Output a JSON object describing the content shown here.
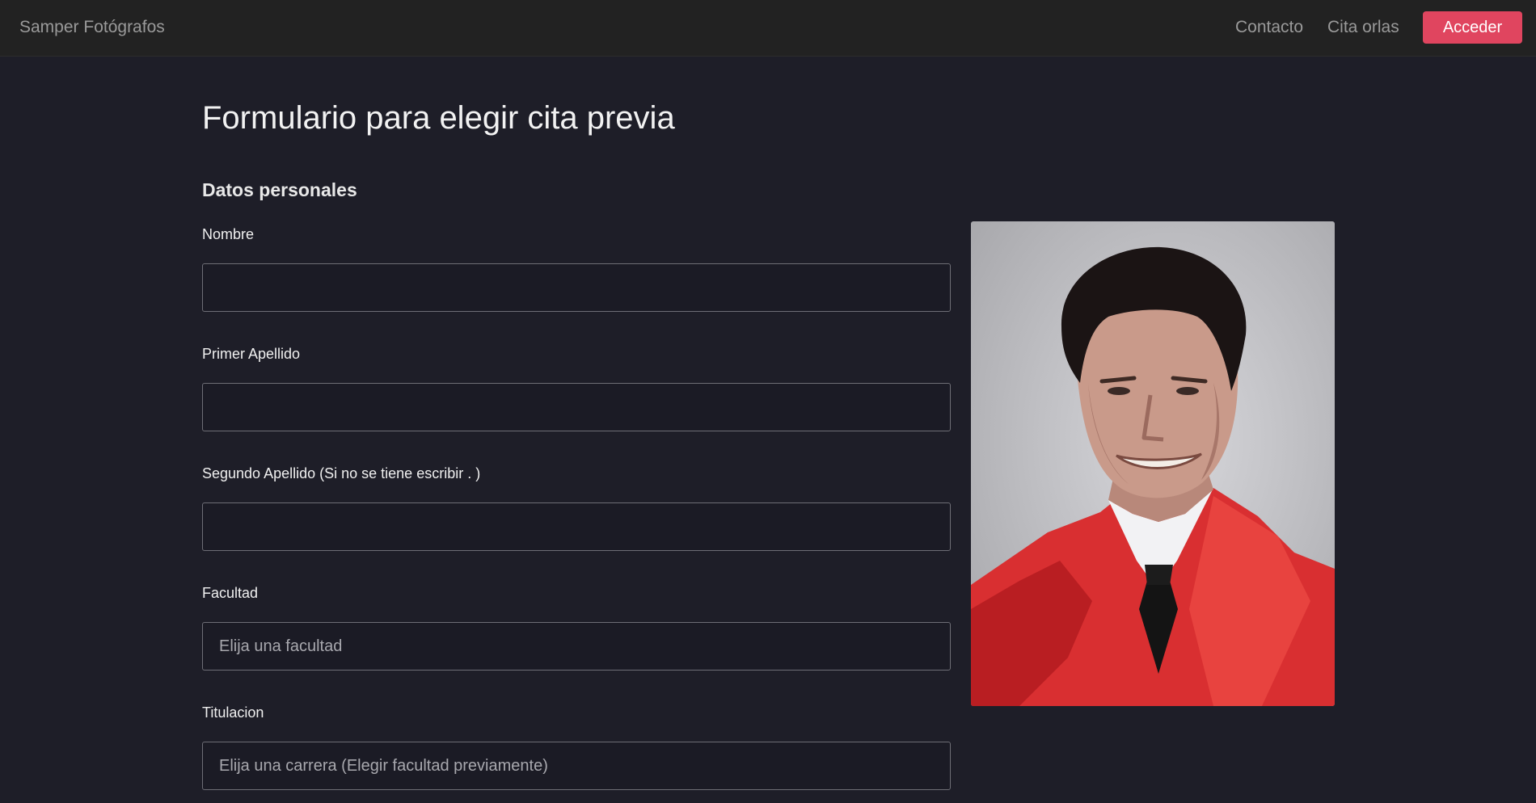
{
  "navbar": {
    "brand": "Samper Fotógrafos",
    "links": [
      "Contacto",
      "Cita orlas"
    ],
    "login_button": "Acceder",
    "accent_color": "#e0455f"
  },
  "main": {
    "title": "Formulario para elegir cita previa",
    "section_title": "Datos personales",
    "fields": [
      {
        "label": "Nombre",
        "value": "",
        "placeholder": ""
      },
      {
        "label": "Primer Apellido",
        "value": "",
        "placeholder": ""
      },
      {
        "label": "Segundo Apellido (Si no se tiene escribir . )",
        "value": "",
        "placeholder": ""
      },
      {
        "label": "Facultad",
        "selected": "Elija una facultad"
      },
      {
        "label": "Titulacion",
        "selected": "Elija una carrera (Elegir facultad previamente)"
      }
    ]
  },
  "illustration": {
    "subject": "portrait of smiling man in red graduation gown with white shirt and black tie"
  }
}
